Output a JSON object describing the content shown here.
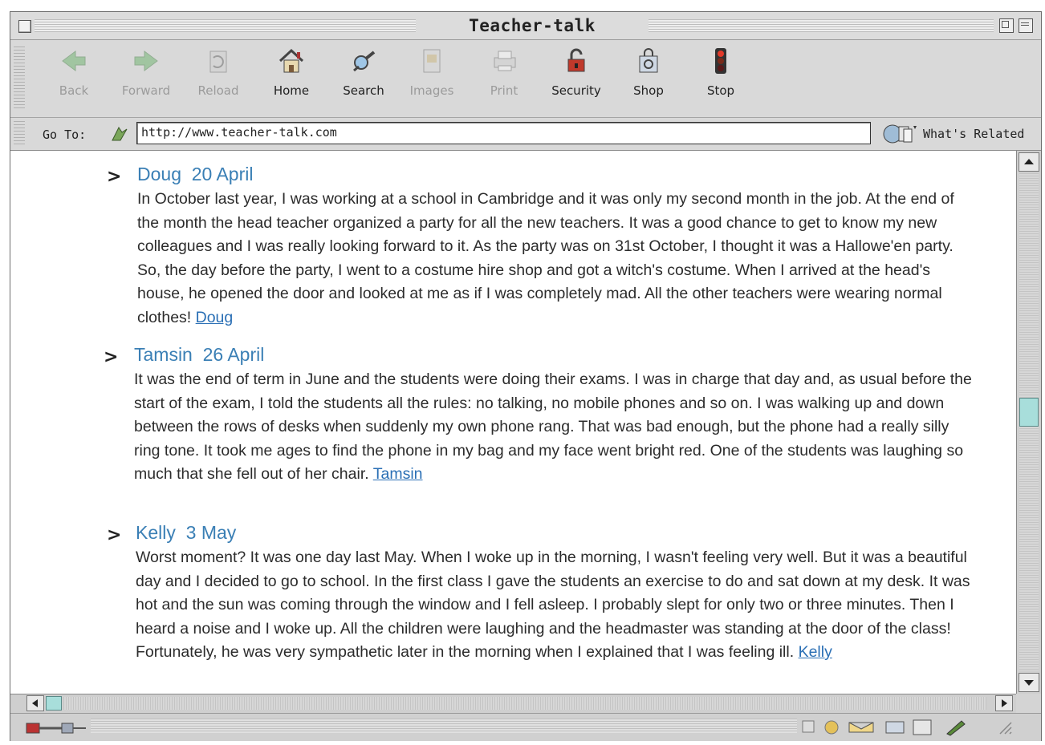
{
  "window": {
    "title": "Teacher-talk"
  },
  "toolbar": {
    "buttons": [
      {
        "label": "Back",
        "icon": "back-arrow-icon",
        "enabled": false
      },
      {
        "label": "Forward",
        "icon": "forward-arrow-icon",
        "enabled": false
      },
      {
        "label": "Reload",
        "icon": "reload-icon",
        "enabled": false
      },
      {
        "label": "Home",
        "icon": "home-icon",
        "enabled": true
      },
      {
        "label": "Search",
        "icon": "search-icon",
        "enabled": true
      },
      {
        "label": "Images",
        "icon": "images-icon",
        "enabled": false
      },
      {
        "label": "Print",
        "icon": "printer-icon",
        "enabled": false
      },
      {
        "label": "Security",
        "icon": "padlock-icon",
        "enabled": true
      },
      {
        "label": "Shop",
        "icon": "shopping-bag-icon",
        "enabled": true
      },
      {
        "label": "Stop",
        "icon": "stop-light-icon",
        "enabled": true
      }
    ]
  },
  "location": {
    "label": "Go To:",
    "url": "http://www.teacher-talk.com",
    "related_label": "What's Related"
  },
  "entries": [
    {
      "marker": ">",
      "author": "Doug",
      "date": "20 April",
      "body": "In October last year, I was working at a school in Cambridge and it was only my second month in the job. At the end of the month the head teacher organized a party for all the new teachers. It was a good chance to get to know my new colleagues and I was really looking forward to it. As the party was on 31st October, I thought it was a Hallowe'en party. So, the day before the party, I went to a costume hire shop and got a witch's costume. When I arrived at the head's house, he opened the door and looked at me as if I was completely mad. All the other teachers were wearing normal clothes!",
      "signature": "Doug"
    },
    {
      "marker": ">",
      "author": "Tamsin",
      "date": "26 April",
      "body": "It was the end of term in June and the students were doing their exams. I was in charge that day and, as usual before the start of the exam, I told the students all the rules: no talking, no mobile phones and so on. I was walking up and down between the rows of desks when suddenly my own phone rang. That was bad enough, but the phone had a really silly ring tone. It took me ages to find the phone in my bag and my face went bright red. One of the students was laughing so much that she fell out of her chair.",
      "signature": "Tamsin"
    },
    {
      "marker": ">",
      "author": "Kelly",
      "date": "3 May",
      "body": "Worst moment? It was one day last May. When I woke up in the morning, I wasn't feeling very well. But it was a beautiful day and I decided to go to school. In the first class I gave the students an exercise to do and sat down at my desk. It was hot and the sun was coming through the window and I fell asleep. I probably slept for only two or three minutes. Then I heard a noise and I woke up. All the children were laughing and the headmaster was standing at the door of the class! Fortunately, he was very sympathetic later in the morning when I explained that I was feeling ill.",
      "signature": "Kelly"
    }
  ],
  "colors": {
    "heading": "#3a7fb5",
    "link": "#2a6fb5",
    "scroll_thumb": "#a8dedb"
  },
  "scroll": {
    "vertical_position": 0.5,
    "horizontal_position": 0.0
  }
}
